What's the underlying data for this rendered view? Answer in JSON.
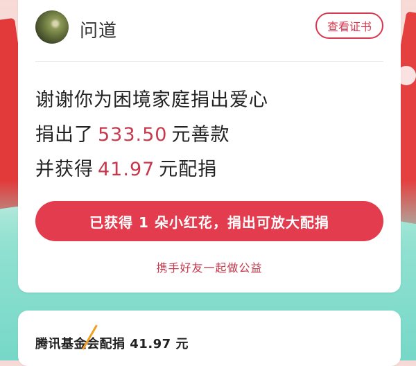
{
  "header": {
    "user_name": "问道",
    "cert_button": "查看证书"
  },
  "donation": {
    "thanks_text": "谢谢你为困境家庭捐出爱心",
    "donated_prefix": "捐出了",
    "donated_amount": "533.50",
    "donated_suffix": "元善款",
    "matched_prefix": "并获得",
    "matched_amount": "41.97",
    "matched_suffix": "元配捐"
  },
  "cta": {
    "button_label": "已获得 1 朵小红花，捐出可放大配捐",
    "invite_link": "携手好友一起做公益"
  },
  "bottom_card": {
    "match_text": "腾讯基金会配捐 41.97 元"
  },
  "colors": {
    "accent": "#e23c4e",
    "amount": "#c8384c"
  }
}
